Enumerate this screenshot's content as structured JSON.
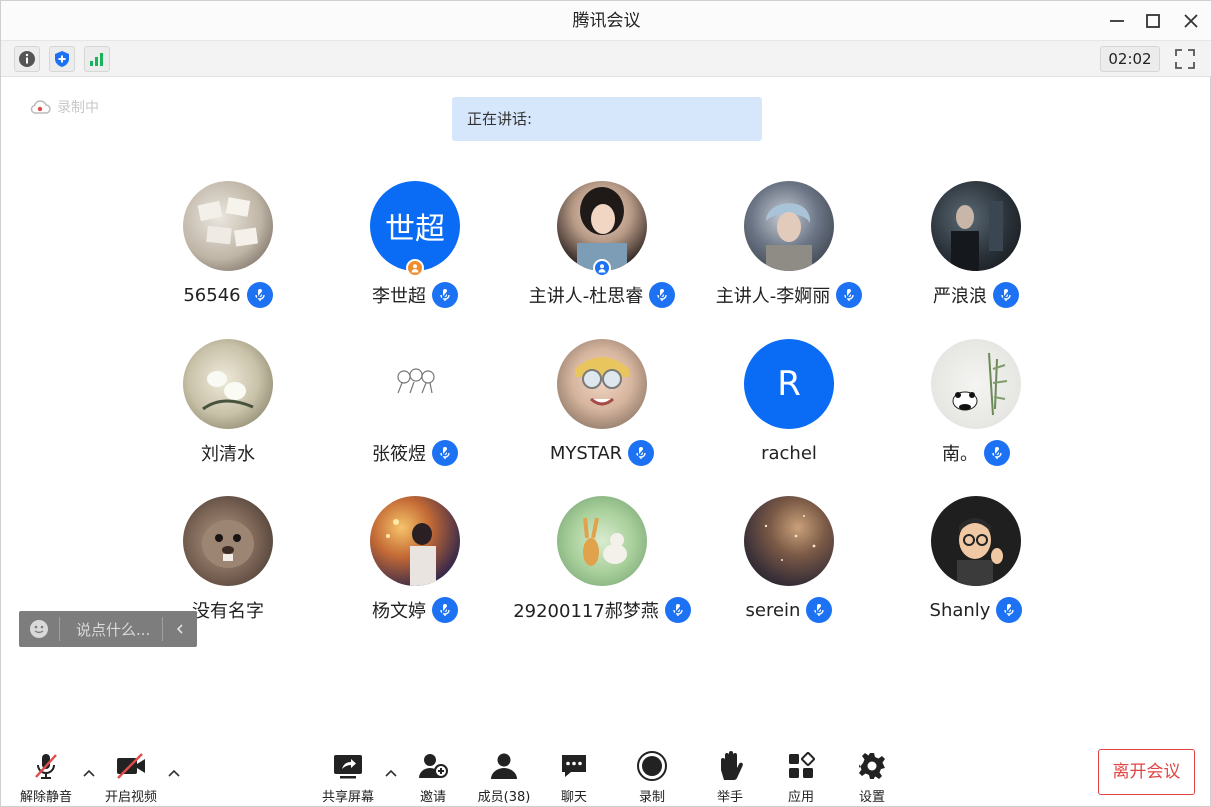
{
  "window": {
    "title": "腾讯会议"
  },
  "top_bar": {
    "icons": [
      "info-icon",
      "shield-icon",
      "signal-bars-icon"
    ],
    "timer": "02:02",
    "fullscreen_icon": "fullscreen-icon"
  },
  "recording": {
    "label": "录制中"
  },
  "speaking": {
    "label": "正在讲话:"
  },
  "participants": [
    {
      "name": "56546",
      "avatar_type": "photo",
      "mic": true
    },
    {
      "name": "李世超",
      "avatar_type": "text",
      "avatar_text": "世超",
      "mic": true,
      "role_badge": "host"
    },
    {
      "name": "主讲人-杜思睿",
      "avatar_type": "photo",
      "mic": true,
      "role_badge": "cohost"
    },
    {
      "name": "主讲人-李婀丽",
      "avatar_type": "photo",
      "mic": true
    },
    {
      "name": "严浪浪",
      "avatar_type": "photo",
      "mic": true
    },
    {
      "name": "刘清水",
      "avatar_type": "photo",
      "mic": false
    },
    {
      "name": "张筱煜",
      "avatar_type": "photo",
      "mic": true
    },
    {
      "name": "MYSTAR",
      "avatar_type": "photo",
      "mic": true
    },
    {
      "name": "rachel",
      "avatar_type": "text",
      "avatar_text": "R",
      "mic": false
    },
    {
      "name": "南。",
      "avatar_type": "photo",
      "mic": true
    },
    {
      "name": "没有名字",
      "avatar_type": "photo",
      "mic": false
    },
    {
      "name": "杨文婷",
      "avatar_type": "photo",
      "mic": true
    },
    {
      "name": "29200117郝梦燕",
      "avatar_type": "photo",
      "mic": true
    },
    {
      "name": "serein",
      "avatar_type": "photo",
      "mic": true
    },
    {
      "name": "Shanly",
      "avatar_type": "photo",
      "mic": true
    }
  ],
  "chat": {
    "placeholder": "说点什么..."
  },
  "toolbar": {
    "unmute": "解除静音",
    "video": "开启视频",
    "share": "共享屏幕",
    "invite": "邀请",
    "members": "成员(38)",
    "chat": "聊天",
    "record": "录制",
    "raise_hand": "举手",
    "apps": "应用",
    "settings": "设置",
    "leave": "离开会议"
  },
  "colors": {
    "accent": "#1d72f3",
    "speaking_bg": "#d6e7fb",
    "leave": "#e14545"
  }
}
